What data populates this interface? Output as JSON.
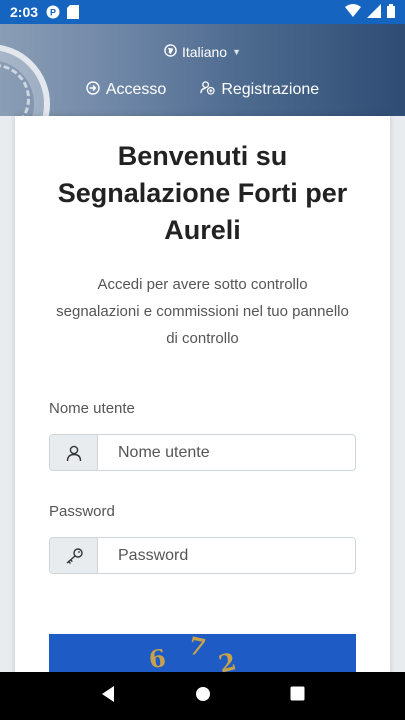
{
  "status_bar": {
    "time": "2:03"
  },
  "header": {
    "language": "Italiano",
    "nav": [
      {
        "label": "Accesso"
      },
      {
        "label": "Registrazione"
      }
    ]
  },
  "card": {
    "title": "Benvenuti su Segnalazione Forti per Aureli",
    "subtitle": "Accedi per avere sotto controllo segnalazioni e commissioni nel tuo pannello di controllo",
    "username": {
      "label": "Nome utente",
      "placeholder": "Nome utente"
    },
    "password": {
      "label": "Password",
      "placeholder": "Password"
    },
    "captcha": [
      "6",
      "7",
      "2"
    ]
  },
  "colors": {
    "status_bar": "#1565c0",
    "captcha_bg": "#1f5bc4",
    "captcha_text": "#c8a24a"
  }
}
